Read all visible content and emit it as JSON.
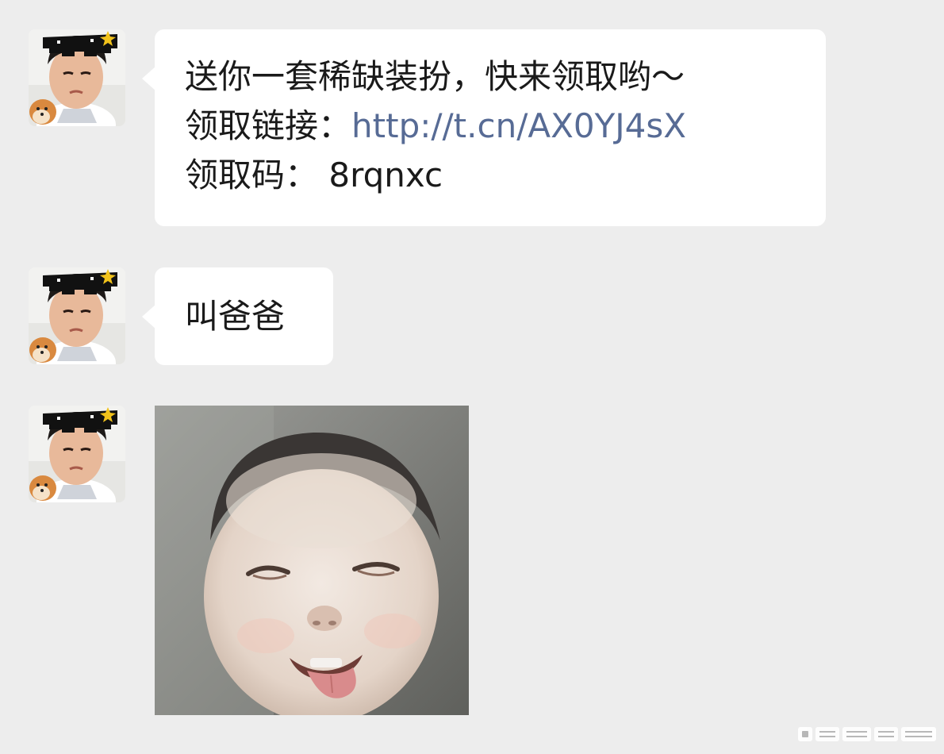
{
  "messages": [
    {
      "type": "text",
      "line1": "送你一套稀缺装扮，快来领取哟～",
      "line2_label": "领取链接：",
      "link_text": "http://t.cn/AX0YJ4sX",
      "line3": "领取码： 8rqnxc"
    },
    {
      "type": "text",
      "text": "叫爸爸"
    },
    {
      "type": "image",
      "image_name": "smiling-baby-sticker"
    }
  ],
  "avatar": {
    "icon": "boy-with-pixel-sunglasses-avatar"
  },
  "watermark": {
    "icon": "weibo-watermark"
  },
  "colors": {
    "background": "#ededed",
    "bubble": "#ffffff",
    "link": "#576b95",
    "text": "#1a1a1a"
  }
}
